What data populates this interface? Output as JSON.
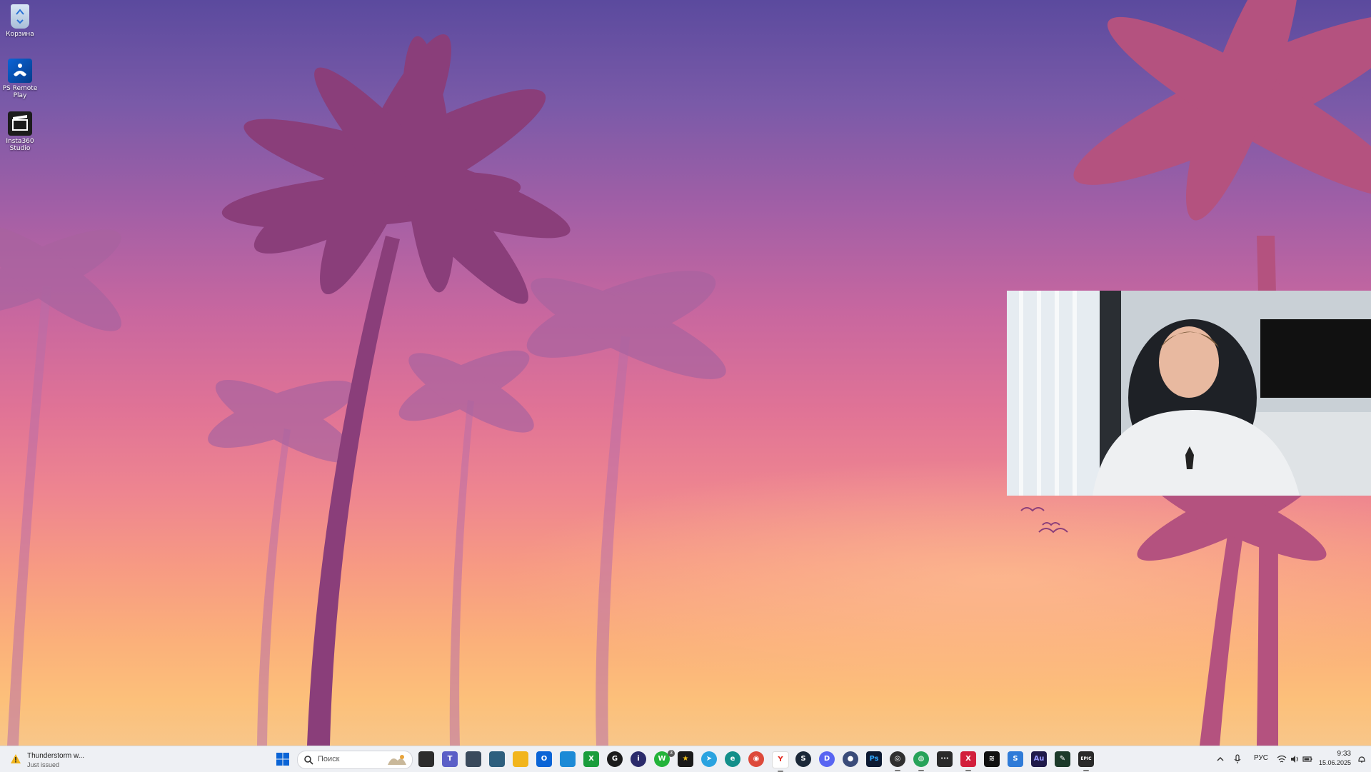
{
  "desktop": {
    "icons": [
      {
        "label": "Корзина",
        "icon": "recycle-bin-icon"
      },
      {
        "label": "PS Remote Play",
        "icon": "ps-remote-play-icon"
      },
      {
        "label": "Insta360 Studio",
        "icon": "insta360-studio-icon"
      }
    ]
  },
  "taskbar": {
    "weather": {
      "title": "Thunderstorm w...",
      "subtitle": "Just issued",
      "icon": "storm-warning-icon"
    },
    "search": {
      "placeholder": "Поиск"
    },
    "apps": [
      {
        "name": "file-explorer-app",
        "glyph": ""
      },
      {
        "name": "teams-app",
        "glyph": "T"
      },
      {
        "name": "camera-app",
        "glyph": ""
      },
      {
        "name": "calculator-app",
        "glyph": ""
      },
      {
        "name": "folder-app",
        "glyph": ""
      },
      {
        "name": "outlook-app",
        "glyph": "O"
      },
      {
        "name": "feather-app",
        "glyph": ""
      },
      {
        "name": "xbox-app",
        "glyph": "X"
      },
      {
        "name": "g-app",
        "glyph": "G"
      },
      {
        "name": "info-app",
        "glyph": "i"
      },
      {
        "name": "whatsapp-app",
        "glyph": "W"
      },
      {
        "name": "star-app",
        "glyph": "★"
      },
      {
        "name": "telegram-app",
        "glyph": "➤"
      },
      {
        "name": "edge-app",
        "glyph": "e"
      },
      {
        "name": "chrome-app",
        "glyph": "◉"
      },
      {
        "name": "yandex-browser-app",
        "glyph": "Y"
      },
      {
        "name": "steam-app",
        "glyph": "S"
      },
      {
        "name": "discord-app",
        "glyph": "D"
      },
      {
        "name": "circle-app",
        "glyph": "●"
      },
      {
        "name": "photoshop-app",
        "glyph": "Ps"
      },
      {
        "name": "obs-app",
        "glyph": "◎"
      },
      {
        "name": "globe-app",
        "glyph": "◍"
      },
      {
        "name": "dots-app",
        "glyph": "···"
      },
      {
        "name": "x-app",
        "glyph": "X"
      },
      {
        "name": "capcut-app",
        "glyph": "≋"
      },
      {
        "name": "blue-app",
        "glyph": "S"
      },
      {
        "name": "audition-app",
        "glyph": "Au"
      },
      {
        "name": "tool-app",
        "glyph": "✎"
      },
      {
        "name": "epic-games-app",
        "glyph": "EPIC"
      }
    ],
    "whatsapp_badge": "3",
    "tray": {
      "language": "РУС",
      "time": "9:33",
      "date": "15.06.2025"
    }
  },
  "colors": {
    "taskbar_bg": "#eef0f4",
    "accent": "#0a64d6"
  }
}
